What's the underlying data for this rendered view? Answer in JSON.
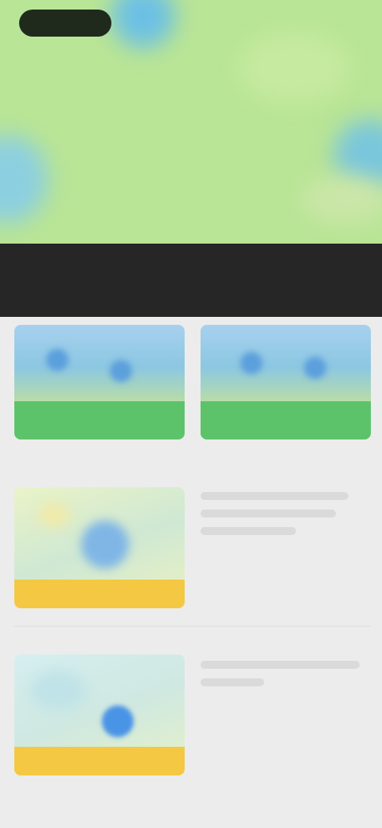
{
  "hero": {
    "back_label": ""
  },
  "header": {
    "title": ""
  },
  "tabs": [
    {
      "label": ""
    },
    {
      "label": ""
    },
    {
      "label": ""
    }
  ],
  "cards": [
    {
      "label": ""
    },
    {
      "label": ""
    }
  ],
  "list": [
    {
      "caption": "",
      "map_label": "",
      "description": ""
    },
    {
      "caption": "",
      "map_label": "",
      "description": ""
    }
  ],
  "colors": {
    "hero_green": "#b9e596",
    "header_dark": "#262626",
    "tab_active": "#e7b84a",
    "card_green": "#5cc36a",
    "map_yellow": "#f4c842",
    "background": "#ececec"
  }
}
